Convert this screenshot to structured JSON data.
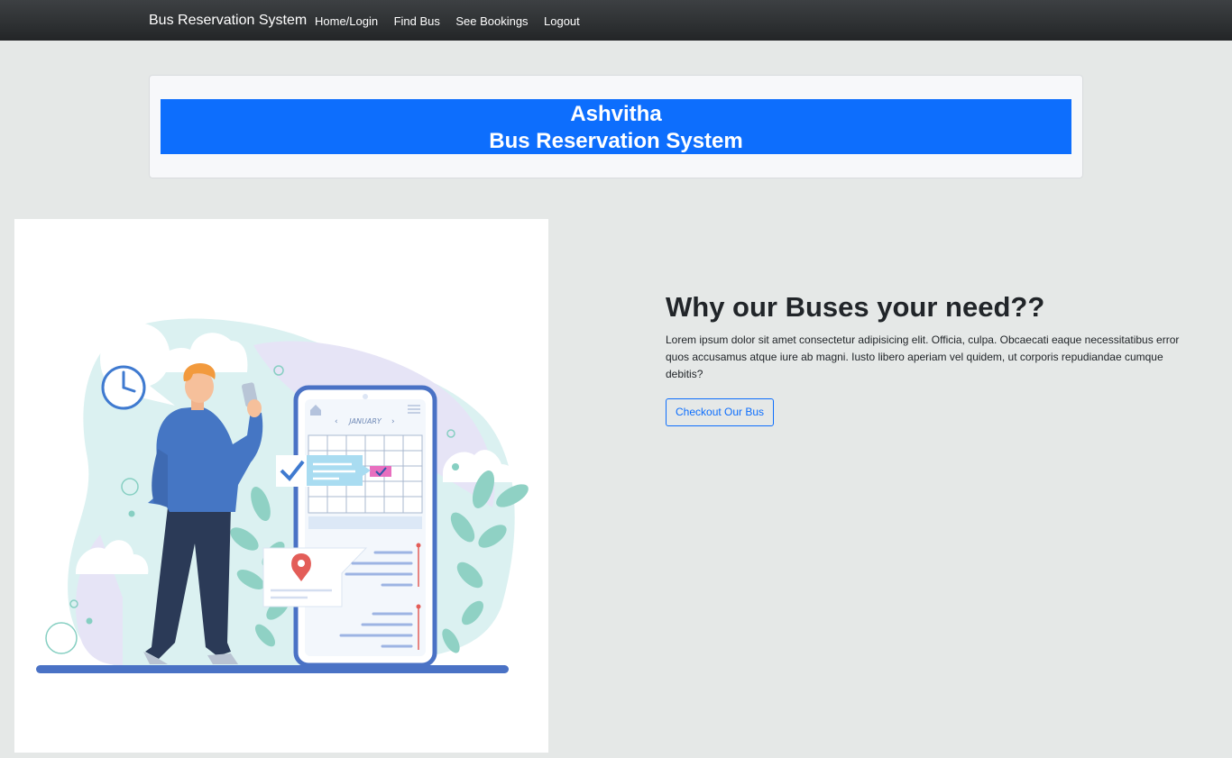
{
  "navbar": {
    "brand": "Bus Reservation System",
    "links": [
      "Home/Login",
      "Find Bus",
      "See Bookings",
      "Logout"
    ]
  },
  "hero": {
    "line1": "Ashvitha",
    "line2": "Bus Reservation System"
  },
  "illustration": {
    "calendar_month": "JANUARY",
    "subject": "person-with-phone-booking-calendar-illustration"
  },
  "info": {
    "title": "Why our Buses your need??",
    "text": "Lorem ipsum dolor sit amet consectetur adipisicing elit. Officia, culpa. Obcaecati eaque necessitatibus error quos accusamus atque iure ab magni. Iusto libero aperiam vel quidem, ut corporis repudiandae cumque debitis?",
    "button_label": "Checkout Our Bus"
  },
  "colors": {
    "navbar": "#2f3234",
    "primary": "#0d6efd",
    "page_background": "#e5e8e7"
  }
}
